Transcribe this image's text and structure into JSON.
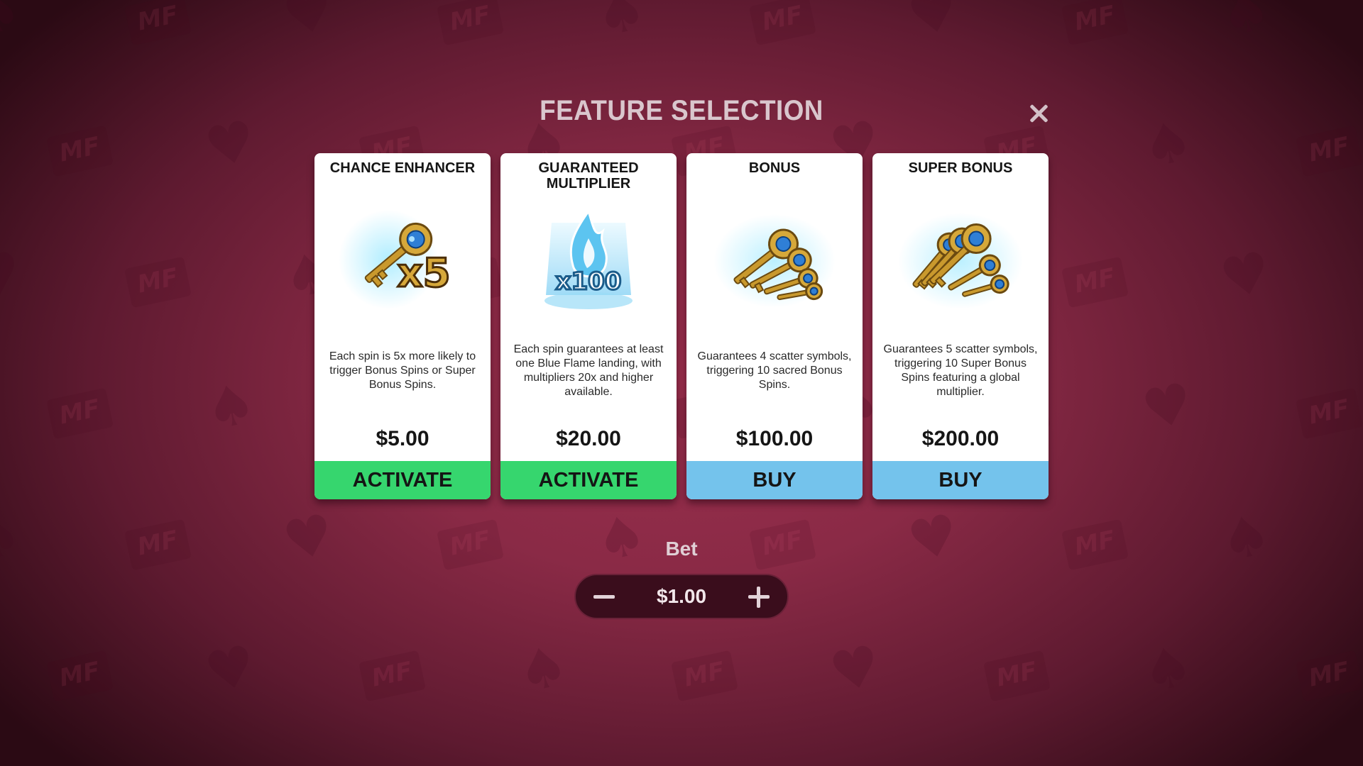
{
  "modal": {
    "title": "FEATURE SELECTION",
    "close_icon": "close-icon"
  },
  "cards": [
    {
      "title": "CHANCE ENHANCER",
      "icon": "key-x5-icon",
      "image_text": "x5",
      "description": "Each spin is 5x more likely to trigger Bonus Spins or Super Bonus Spins.",
      "price": "$5.00",
      "action": "ACTIVATE",
      "action_color": "#36d66e"
    },
    {
      "title": "GUARANTEED MULTIPLIER",
      "icon": "blue-flame-x100-icon",
      "image_text": "x100",
      "description": "Each spin guarantees at least one Blue Flame landing, with multipliers 20x and higher available.",
      "price": "$20.00",
      "action": "ACTIVATE",
      "action_color": "#36d66e"
    },
    {
      "title": "BONUS",
      "icon": "four-keys-icon",
      "description": "Guarantees 4 scatter symbols, triggering 10 sacred Bonus Spins.",
      "price": "$100.00",
      "action": "BUY",
      "action_color": "#74c3ec"
    },
    {
      "title": "SUPER BONUS",
      "icon": "five-keys-icon",
      "description": "Guarantees 5 scatter symbols, triggering 10 Super Bonus Spins featuring a global multiplier.",
      "price": "$200.00",
      "action": "BUY",
      "action_color": "#74c3ec"
    }
  ],
  "bet": {
    "label": "Bet",
    "value": "$1.00",
    "minus_icon": "minus-icon",
    "plus_icon": "plus-icon"
  },
  "background": {
    "watermark_text": "MF",
    "suits": [
      "♠",
      "♣",
      "♥",
      "♦"
    ],
    "base_color": "#8a2a46"
  }
}
